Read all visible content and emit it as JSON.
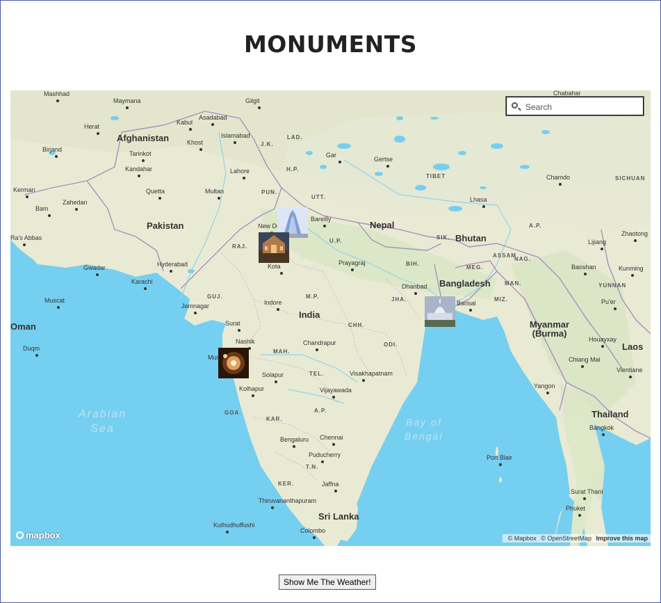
{
  "page": {
    "title": "MONUMENTS"
  },
  "search": {
    "placeholder": "Search"
  },
  "labels": {
    "countries": [
      "Afghanistan",
      "Pakistan",
      "Nepal",
      "Bhutan",
      "Bangladesh",
      "India",
      "Myanmar\n(Burma)",
      "Laos",
      "Thailand",
      "Sri Lanka",
      "Oman"
    ],
    "states": [
      "J.K.",
      "LAD.",
      "H.P.",
      "PUN.",
      "UTT.",
      "RAJ.",
      "U.P.",
      "BIH.",
      "MEG.",
      "ASSAM",
      "NAG.",
      "MAN.",
      "MIZ.",
      "JHA.",
      "M.P.",
      "GUJ.",
      "CHH.",
      "ODI.",
      "MAH.",
      "TEL.",
      "A.P.",
      "GOA",
      "KAR.",
      "T.N.",
      "KER.",
      "SIK.",
      "A.P.",
      "SICHUAN",
      "YUNNAN",
      "TIBET"
    ],
    "cities": [
      "Mashhad",
      "Maymana",
      "Gilgit",
      "Herat",
      "Kabul",
      "Asadabad",
      "Khost",
      "Islamabad",
      "Birjand",
      "Tarinkot",
      "Kandahar",
      "Lahore",
      "Gar",
      "Gertse",
      "Kerman",
      "Quetta",
      "Multan",
      "Zahedan",
      "Bam",
      "Lhasa",
      "Chamdo",
      "New Delhi",
      "Bareilly",
      "Kota",
      "Prayagraj",
      "Hyderabad",
      "Karachi",
      "Gwadar",
      "Muscat",
      "Jamnagar",
      "Surat",
      "Indore",
      "Nashik",
      "Mumbai",
      "Chandrapur",
      "Dhanbad",
      "Barisal",
      "Solapur",
      "Kolhapur",
      "Visakhapatnam",
      "Vijayawada",
      "Bengaluru",
      "Chennai",
      "Puducherry",
      "Jaffna",
      "Thiruvananthapuram",
      "Kulhudhuffushi",
      "Colombo",
      "Duqm",
      "Lijiang",
      "Zhaotong",
      "Baoshan",
      "Kunming",
      "Pu'er",
      "Houayxay",
      "Chiang Mai",
      "Vientiane",
      "Yangon",
      "Bangkok",
      "Port Blair",
      "Surat Thani",
      "Phuket",
      "Ra's Abbas",
      "Chabahar"
    ],
    "seas": [
      "Arabian\nSea",
      "Bay of\nBengal"
    ]
  },
  "markers": [
    {
      "name": "New Delhi monument",
      "colors": [
        "#7f9fd6",
        "#c8d6f0"
      ]
    },
    {
      "name": "Rajasthan palace",
      "colors": [
        "#5a4030",
        "#c89060"
      ]
    },
    {
      "name": "Kolkata memorial",
      "colors": [
        "#8a96b0",
        "#d8dce6"
      ]
    },
    {
      "name": "Mumbai monument",
      "colors": [
        "#3a2010",
        "#e0a060"
      ]
    }
  ],
  "map": {
    "logo": "mapbox",
    "attribution": [
      "© Mapbox",
      "© OpenStreetMap",
      "Improve this map"
    ],
    "water_color": "#75cff0",
    "land_color": "#e9ead3"
  },
  "weather_button": {
    "label": "Show Me The Weather!"
  }
}
